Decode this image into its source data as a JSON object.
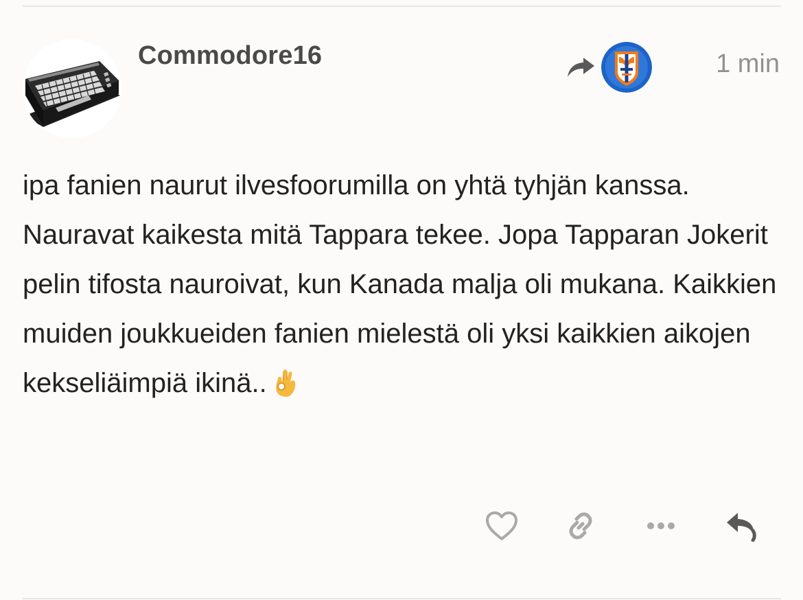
{
  "post": {
    "username": "Commodore16",
    "time": "1 min",
    "body": "ipa fanien naurut ilvesfoorumilla on yhtä tyhjän kanssa. Nauravat kaikesta mitä Tappara tekee. Jopa Tapparan Jokerit pelin tifosta nauroivat, kun Kanada malja oli mukana. Kaikkien muiden joukkueiden fanien mielestä oli yksi kaikkien aikojen kekseliäimpiä ikinä.."
  },
  "icons": {
    "reply_to": "share-arrow-icon",
    "like": "heart-icon",
    "copy_link": "link-icon",
    "more": "ellipsis-icon",
    "reply": "reply-icon",
    "emoji": "ok-hand-emoji"
  },
  "colors": {
    "background": "#fcfbf9",
    "username": "#4a4a4a",
    "muted": "#919191",
    "text": "#222222",
    "icon_light": "#a9a9a9",
    "icon_dark": "#595959"
  }
}
